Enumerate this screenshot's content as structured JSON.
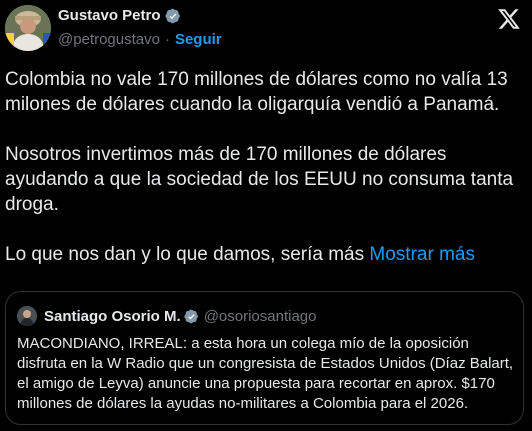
{
  "author": {
    "display_name": "Gustavo Petro",
    "handle": "@petrogustavo",
    "separator": "·",
    "follow_label": "Seguir"
  },
  "icons": {
    "verified": "verified-badge-icon",
    "platform": "x-logo-icon"
  },
  "colors": {
    "background": "#000000",
    "text": "#e7e9ea",
    "muted": "#71767b",
    "accent": "#1d9bf0",
    "verified_badge": "#1d9bf0",
    "border": "#2f3336"
  },
  "tweet": {
    "paragraphs": [
      "Colombia no vale 170 millones de dólares como no valía 13 milones de dólares cuando la oligarquía vendió a Panamá.",
      "Nosotros invertimos más de 170 millones de dólares ayudando a que la sociedad de los EEUU no consuma tanta droga."
    ],
    "last_line": "Lo que nos dan y lo que damos, sería más",
    "show_more_label": "Mostrar más"
  },
  "quoted_tweet": {
    "display_name": "Santiago Osorio M.",
    "handle": "@osoriosantiago",
    "text": "MACONDIANO, IRREAL: a esta hora un colega mío de la oposición disfruta en la W Radio que un congresista de Estados Unidos (Díaz Balart, el amigo de Leyva) anuncie una propuesta para recortar en  aprox. $170 millones de dólares la ayudas no-militares a Colombia para el 2026."
  }
}
